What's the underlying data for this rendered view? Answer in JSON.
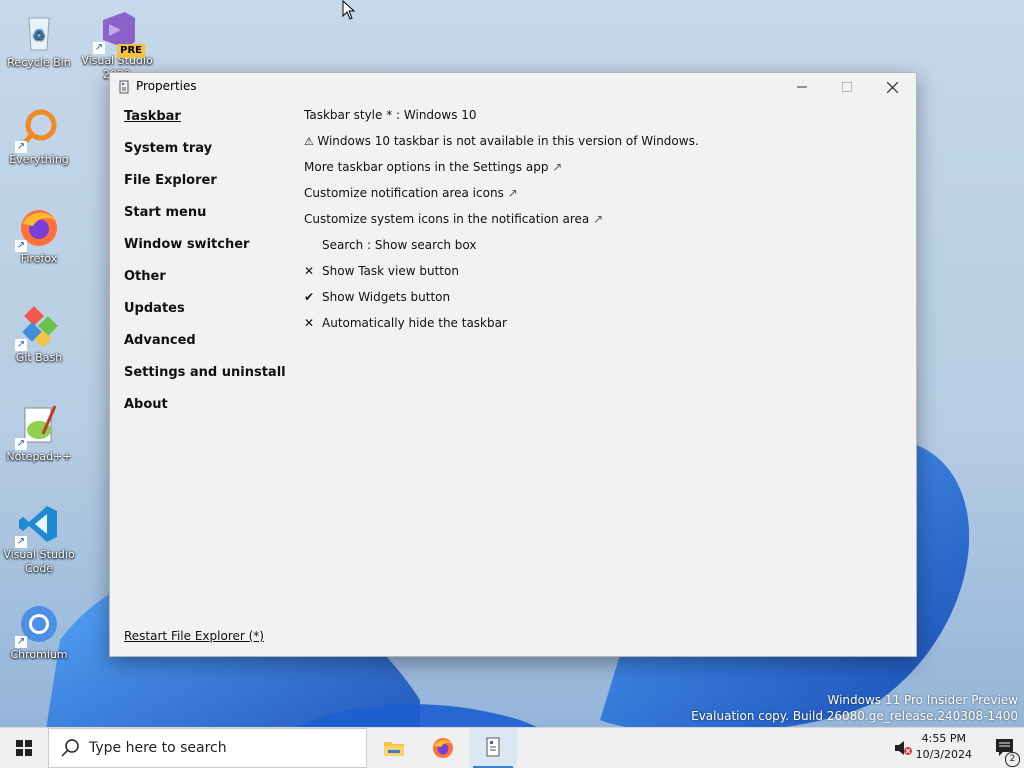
{
  "desktop": {
    "icons": [
      {
        "label": "Recycle Bin"
      },
      {
        "label": "Visual Studio 2022"
      },
      {
        "label": "Everything"
      },
      {
        "label": "Firefox"
      },
      {
        "label": "Git Bash"
      },
      {
        "label": "Notepad++"
      },
      {
        "label": "Visual Studio Code"
      },
      {
        "label": "Chromium"
      }
    ],
    "vs_badge": "PRE"
  },
  "window": {
    "title": "Properties",
    "nav": [
      {
        "label": "Taskbar"
      },
      {
        "label": "System tray"
      },
      {
        "label": "File Explorer"
      },
      {
        "label": "Start menu"
      },
      {
        "label": "Window switcher"
      },
      {
        "label": "Other"
      },
      {
        "label": "Updates"
      },
      {
        "label": "Advanced"
      },
      {
        "label": "Settings and uninstall"
      },
      {
        "label": "About"
      }
    ],
    "content": {
      "taskbar_style": "Taskbar style * : Windows 10",
      "warning": "Windows 10 taskbar is not available in this version of Windows.",
      "link_settings": "More taskbar options in the Settings app",
      "link_notif_icons": "Customize notification area icons",
      "link_system_icons": "Customize system icons in the notification area",
      "search_option": "Search : Show search box",
      "task_view": {
        "label": "Show Task view button",
        "state": "off"
      },
      "widgets": {
        "label": "Show Widgets button",
        "state": "on"
      },
      "autohide": {
        "label": "Automatically hide the taskbar",
        "state": "off"
      }
    },
    "restart": "Restart File Explorer (*)"
  },
  "watermark": {
    "line1": "Windows 11 Pro Insider Preview",
    "line2": "Evaluation copy. Build 26080.ge_release.240308-1400"
  },
  "taskbar": {
    "search_placeholder": "Type here to search",
    "time": "4:55 PM",
    "date": "10/3/2024",
    "notification_count": "2"
  },
  "colors": {
    "accent": "#3c7fd1",
    "window_bg": "#f2f2f2"
  }
}
